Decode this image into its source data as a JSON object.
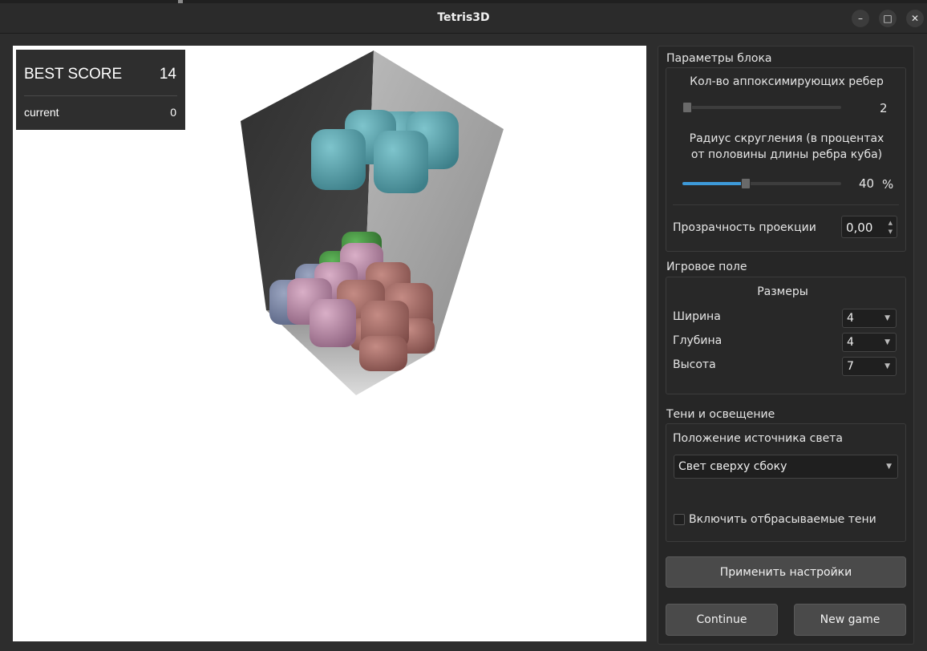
{
  "window": {
    "title": "Tetris3D",
    "controls": {
      "minimize": "–",
      "maximize": "□",
      "close": "✕"
    }
  },
  "score": {
    "best_label": "BEST SCORE",
    "best_value": "14",
    "current_label": "current",
    "current_value": "0"
  },
  "scene": {
    "colors": {
      "wall_left": "#3a3a3a",
      "wall_right": "#a8a8a8",
      "floor": "#c8c8c8",
      "active_piece": "#4f95a0",
      "stack_pink": "#b98aa6",
      "stack_brown": "#a86c66",
      "stack_blue": "#7783a3",
      "stack_green": "#3f8a3c"
    }
  },
  "panel": {
    "block_params": {
      "title": "Параметры блока",
      "edges_label": "Кол-во аппоксимирующих ребер",
      "edges_value": "2",
      "edges_fraction": 0.03,
      "radius_label_line1": "Радиус скругления (в процентах",
      "radius_label_line2": "от половины длины ребра куба)",
      "radius_value": "40",
      "radius_unit": "%",
      "radius_fraction": 0.4,
      "transparency_label": "Прозрачность проекции",
      "transparency_value": "0,00"
    },
    "field": {
      "title": "Игровое поле",
      "sizes_label": "Размеры",
      "width_label": "Ширина",
      "width_value": "4",
      "depth_label": "Глубина",
      "depth_value": "4",
      "height_label": "Высота",
      "height_value": "7"
    },
    "lighting": {
      "title": "Тени и освещение",
      "light_pos_label": "Положение источника света",
      "light_pos_value": "Свет сверху сбоку",
      "shadows_label": "Включить отбрасываемые тени",
      "shadows_checked": false
    },
    "buttons": {
      "apply": "Применить настройки",
      "continue": "Continue",
      "new_game": "New game"
    }
  }
}
